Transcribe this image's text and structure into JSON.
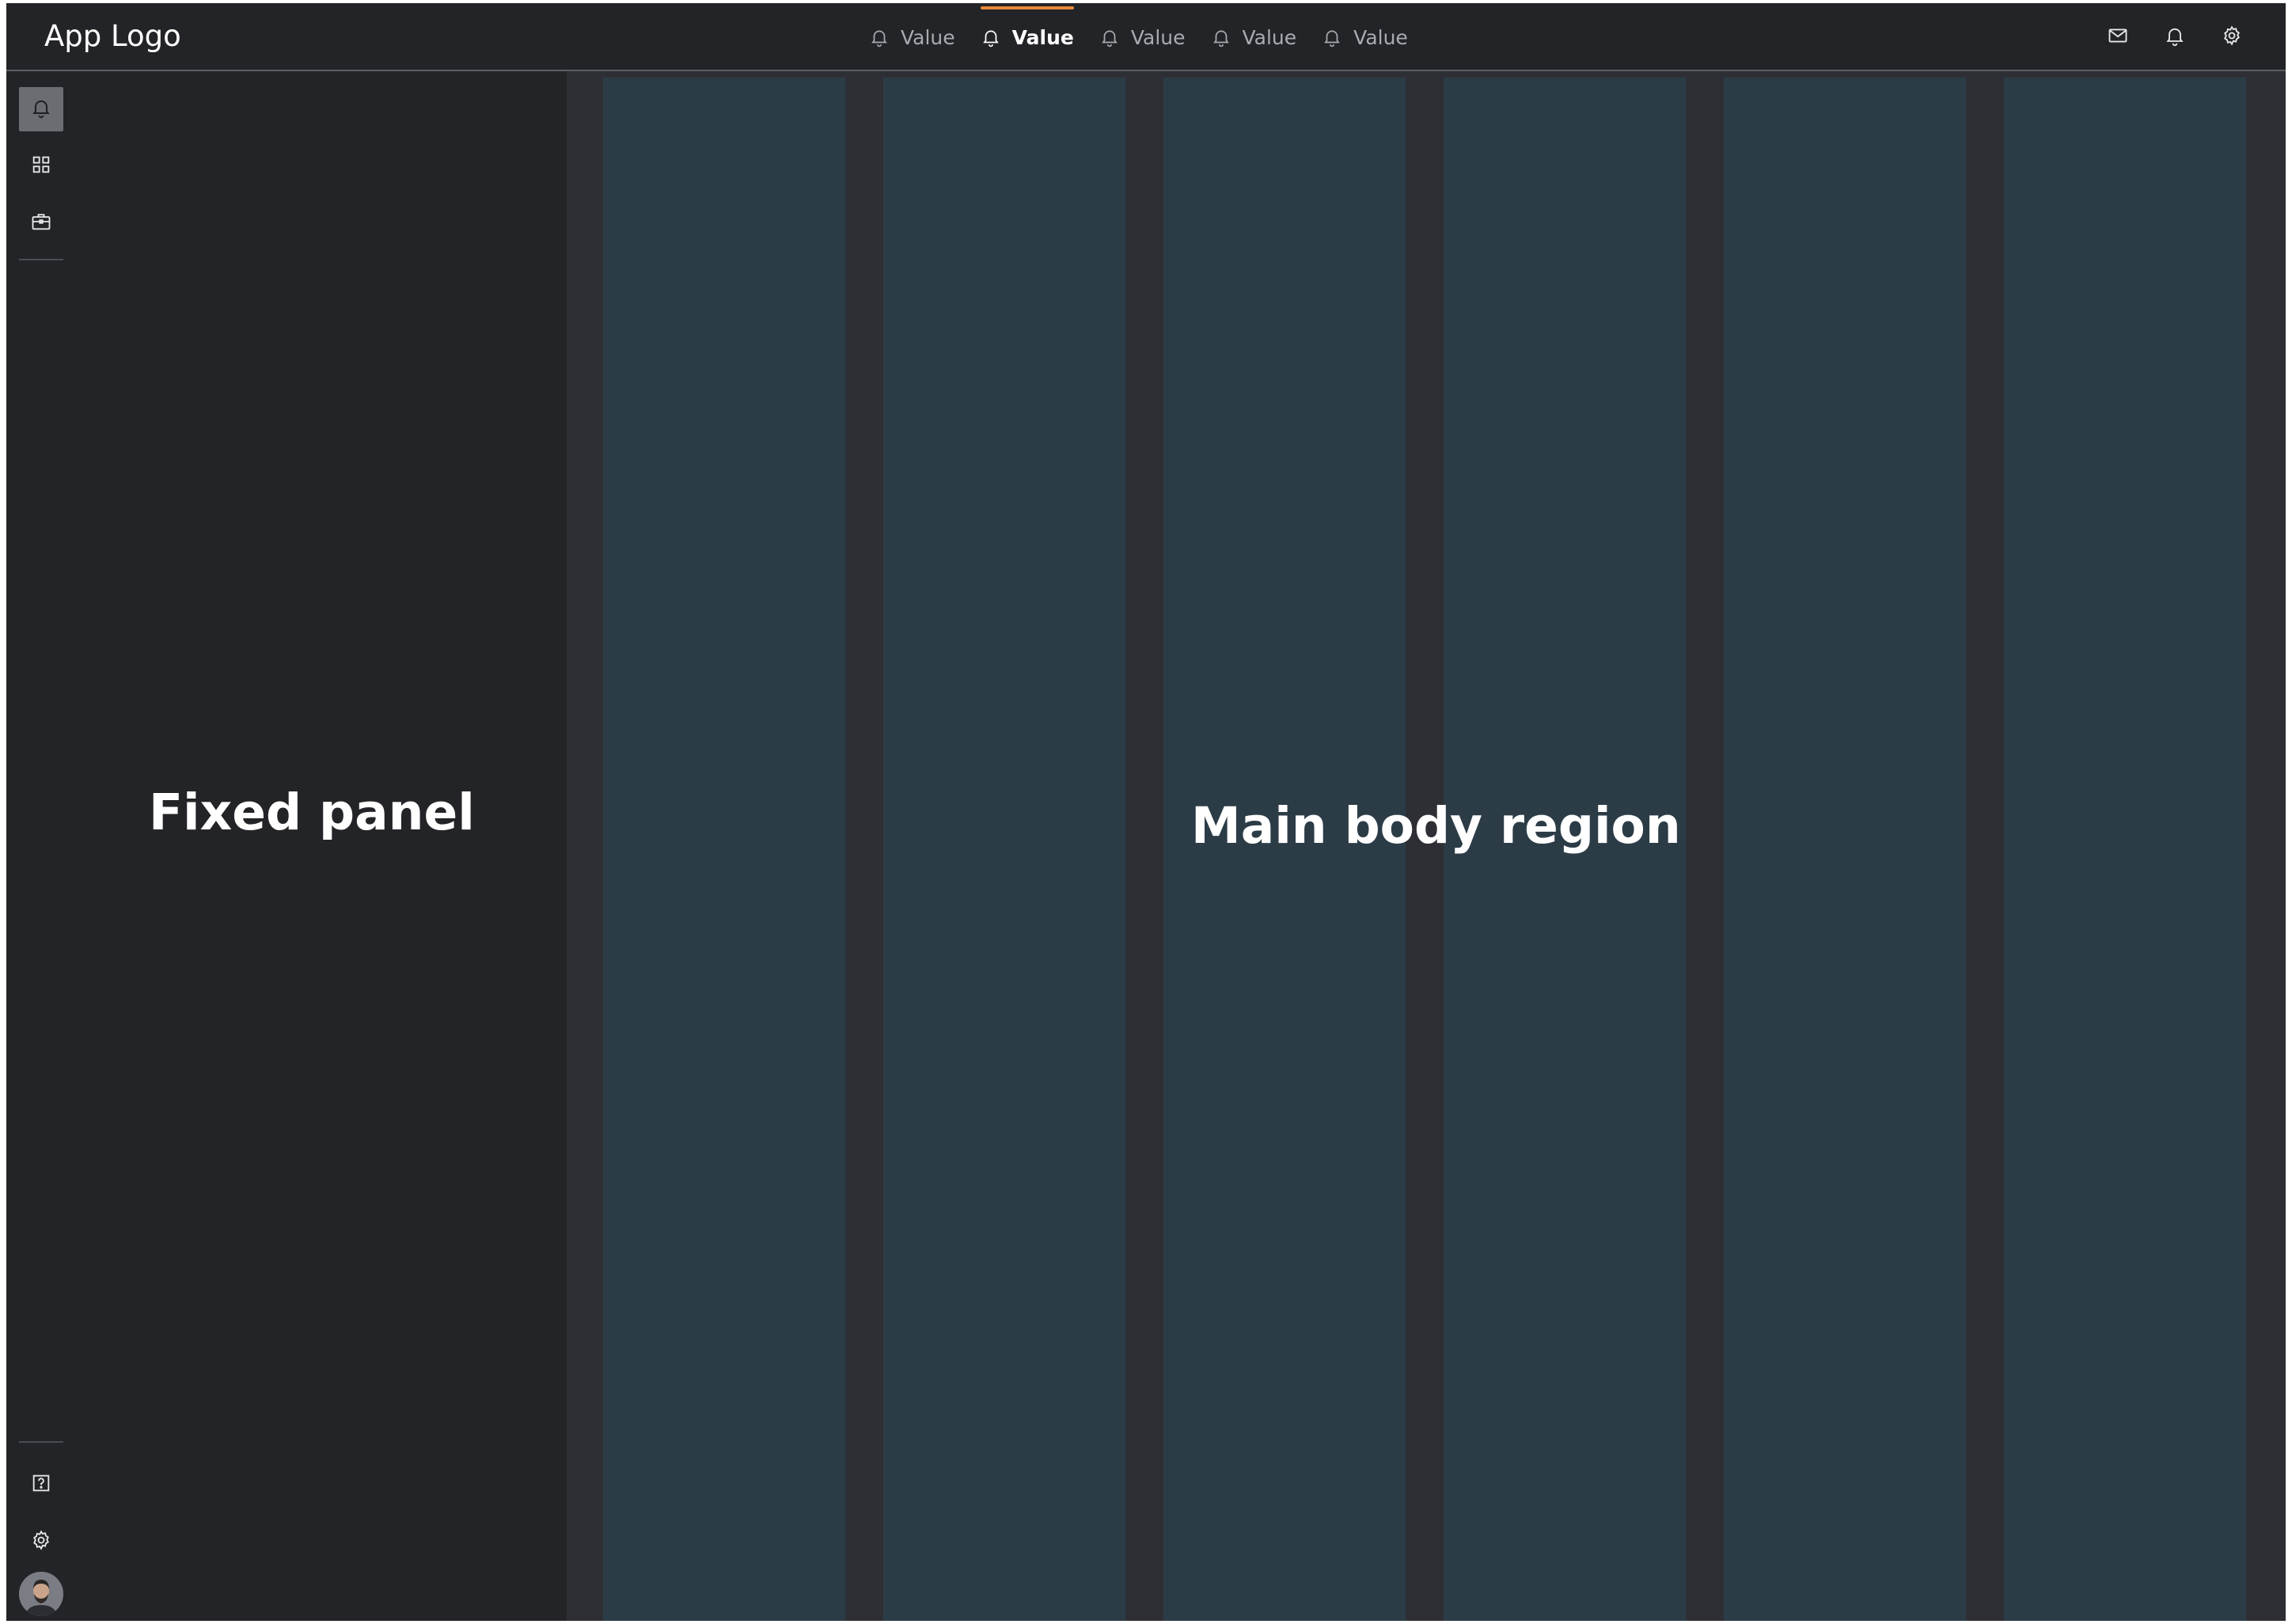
{
  "header": {
    "logo": "App Logo",
    "tabs": [
      {
        "label": "Value",
        "icon": "bell-icon",
        "active": false
      },
      {
        "label": "Value",
        "icon": "bell-icon",
        "active": true
      },
      {
        "label": "Value",
        "icon": "bell-icon",
        "active": false
      },
      {
        "label": "Value",
        "icon": "bell-icon",
        "active": false
      },
      {
        "label": "Value",
        "icon": "bell-icon",
        "active": false
      }
    ],
    "actions": [
      "mail-icon",
      "bell-icon",
      "gear-icon"
    ]
  },
  "rail": {
    "top_items": [
      "bell-icon",
      "grid-icon",
      "briefcase-icon"
    ],
    "bottom_items": [
      "help-icon",
      "gear-icon",
      "avatar"
    ],
    "active_index": 0
  },
  "fixed_panel": {
    "label": "Fixed panel"
  },
  "main_body": {
    "label": "Main body region"
  },
  "colors": {
    "background": "#232427",
    "main_background": "#2e2f35",
    "column": "#2c3c47",
    "accent": "#e8893a",
    "rail_active": "#6b6d72"
  }
}
